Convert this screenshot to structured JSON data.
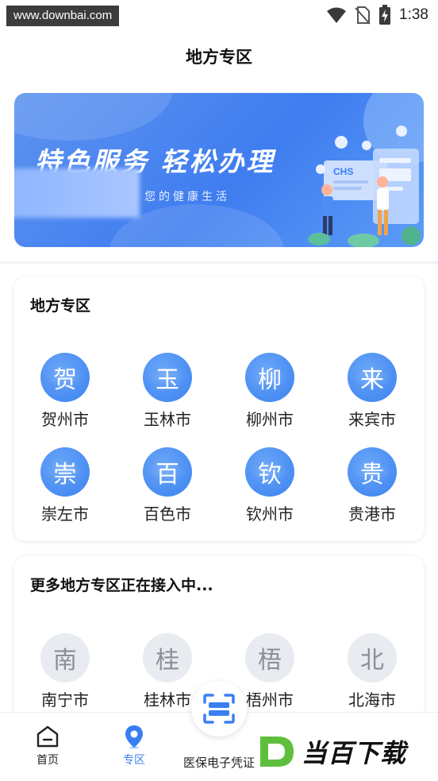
{
  "status_bar": {
    "url_watermark": "www.downbai.com",
    "time": "1:38"
  },
  "header": {
    "title": "地方专区"
  },
  "banner": {
    "headline": "特色服务 轻松办理",
    "subtitle": "您的健康生活",
    "art_badge": "CHS"
  },
  "local_zone": {
    "title": "地方专区",
    "items": [
      {
        "char": "贺",
        "name": "贺州市"
      },
      {
        "char": "玉",
        "name": "玉林市"
      },
      {
        "char": "柳",
        "name": "柳州市"
      },
      {
        "char": "来",
        "name": "来宾市"
      },
      {
        "char": "崇",
        "name": "崇左市"
      },
      {
        "char": "百",
        "name": "百色市"
      },
      {
        "char": "钦",
        "name": "钦州市"
      },
      {
        "char": "贵",
        "name": "贵港市"
      }
    ]
  },
  "more_zone": {
    "title": "更多地方专区正在接入中...",
    "items": [
      {
        "char": "南",
        "name": "南宁市"
      },
      {
        "char": "桂",
        "name": "桂林市"
      },
      {
        "char": "梧",
        "name": "梧州市"
      },
      {
        "char": "北",
        "name": "北海市"
      }
    ]
  },
  "bottom_nav": {
    "home": "首页",
    "zone": "专区",
    "center": "医保电子凭证"
  },
  "brand_watermark": {
    "letter": "D",
    "text": "当百下载"
  },
  "colors": {
    "accent": "#3a7ff2",
    "banner": "#3f7df0",
    "inactive_circle": "#e8ebf0"
  }
}
